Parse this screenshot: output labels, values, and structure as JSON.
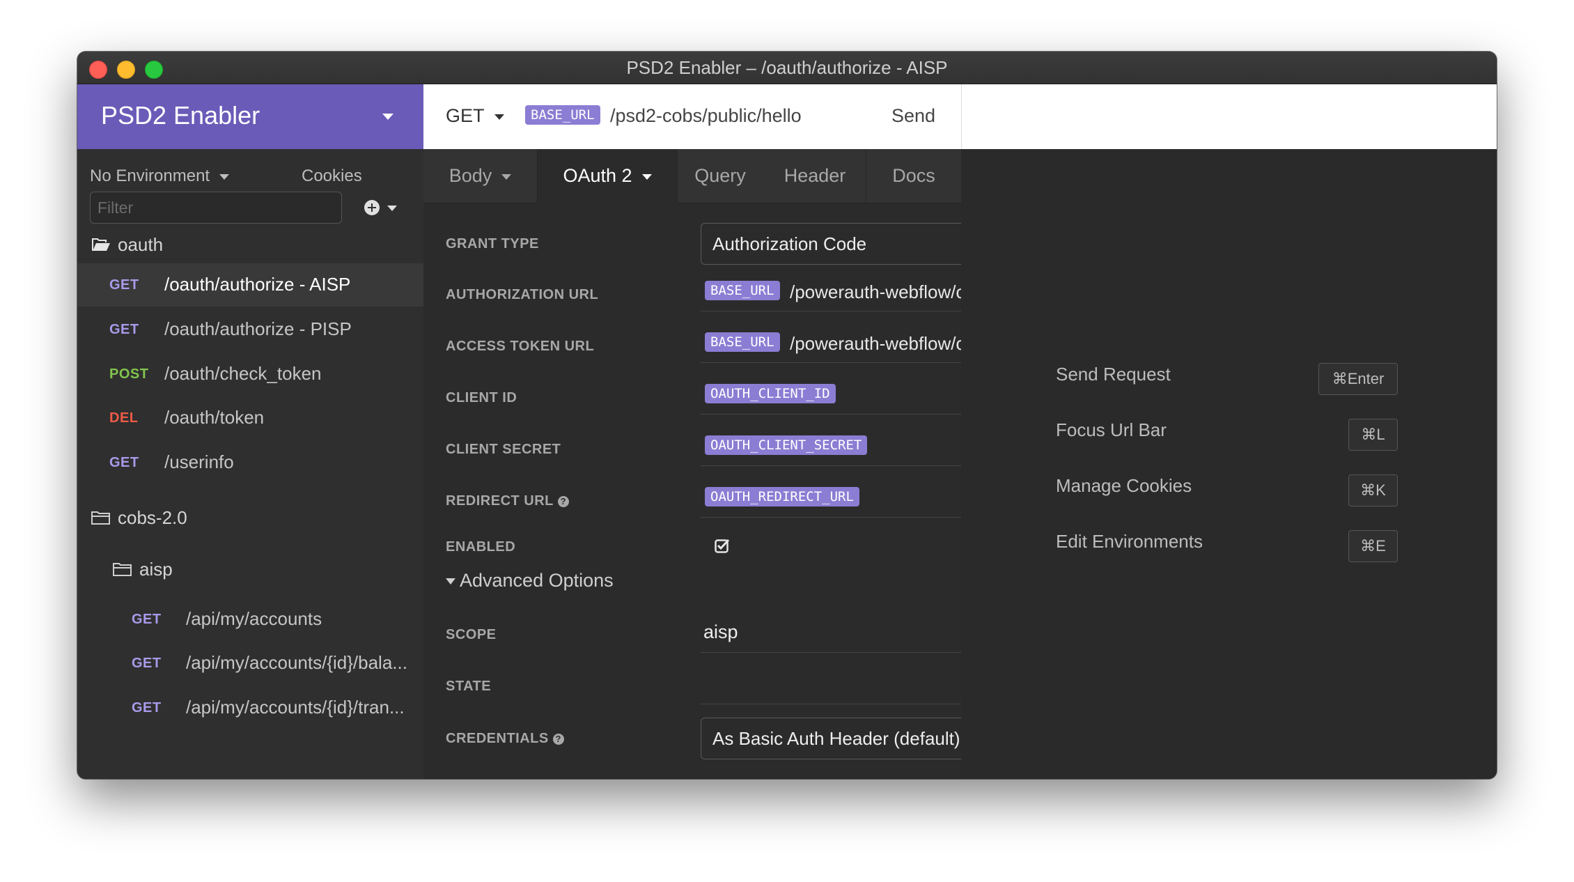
{
  "window": {
    "title": "PSD2 Enabler – /oauth/authorize - AISP"
  },
  "sidebar": {
    "workspace": "PSD2 Enabler",
    "environment": "No Environment",
    "cookies": "Cookies",
    "filter_placeholder": "Filter",
    "tree": [
      {
        "type": "folder",
        "label": "oauth",
        "open": true
      },
      {
        "type": "request",
        "method": "GET",
        "path": "/oauth/authorize - AISP",
        "active": true
      },
      {
        "type": "request",
        "method": "GET",
        "path": "/oauth/authorize - PISP"
      },
      {
        "type": "request",
        "method": "POST",
        "path": "/oauth/check_token"
      },
      {
        "type": "request",
        "method": "DEL",
        "path": "/oauth/token"
      },
      {
        "type": "request",
        "method": "GET",
        "path": "/userinfo"
      },
      {
        "type": "folder",
        "label": "cobs-2.0"
      },
      {
        "type": "folder",
        "label": "aisp"
      },
      {
        "type": "request",
        "method": "GET",
        "path": "/api/my/accounts"
      },
      {
        "type": "request",
        "method": "GET",
        "path": "/api/my/accounts/{id}/bala..."
      },
      {
        "type": "request",
        "method": "GET",
        "path": "/api/my/accounts/{id}/tran..."
      }
    ]
  },
  "urlbar": {
    "method": "GET",
    "variable": "BASE_URL",
    "path": "/psd2-cobs/public/hello",
    "send": "Send"
  },
  "tabs": {
    "body": "Body",
    "auth": "OAuth 2",
    "query": "Query",
    "header": "Header",
    "docs": "Docs"
  },
  "oauth": {
    "grant_type_label": "GRANT TYPE",
    "grant_type_value": "Authorization Code",
    "auth_url_label": "AUTHORIZATION URL",
    "auth_url_var": "BASE_URL",
    "auth_url_text": "/powerauth-webflow/oaut",
    "token_url_label": "ACCESS TOKEN URL",
    "token_url_var": "BASE_URL",
    "token_url_text": "/powerauth-webflow/oaut",
    "client_id_label": "CLIENT ID",
    "client_id_var": "OAUTH_CLIENT_ID",
    "client_secret_label": "CLIENT SECRET",
    "client_secret_var": "OAUTH_CLIENT_SECRET",
    "redirect_url_label": "REDIRECT URL",
    "redirect_url_var": "OAUTH_REDIRECT_URL",
    "enabled_label": "ENABLED",
    "enabled": true,
    "advanced_label": "Advanced Options",
    "scope_label": "SCOPE",
    "scope_value": "aisp",
    "state_label": "STATE",
    "state_value": "",
    "credentials_label": "CREDENTIALS",
    "credentials_value": "As Basic Auth Header (default)"
  },
  "shortcuts": [
    {
      "label": "Send Request",
      "key": "⌘Enter"
    },
    {
      "label": "Focus Url Bar",
      "key": "⌘L"
    },
    {
      "label": "Manage Cookies",
      "key": "⌘K"
    },
    {
      "label": "Edit Environments",
      "key": "⌘E"
    }
  ],
  "colors": {
    "accent": "#6b5bb8",
    "variable_tag": "#8b7dd3",
    "get": "#a99aea",
    "post": "#82c44d",
    "delete": "#ef5a47"
  }
}
